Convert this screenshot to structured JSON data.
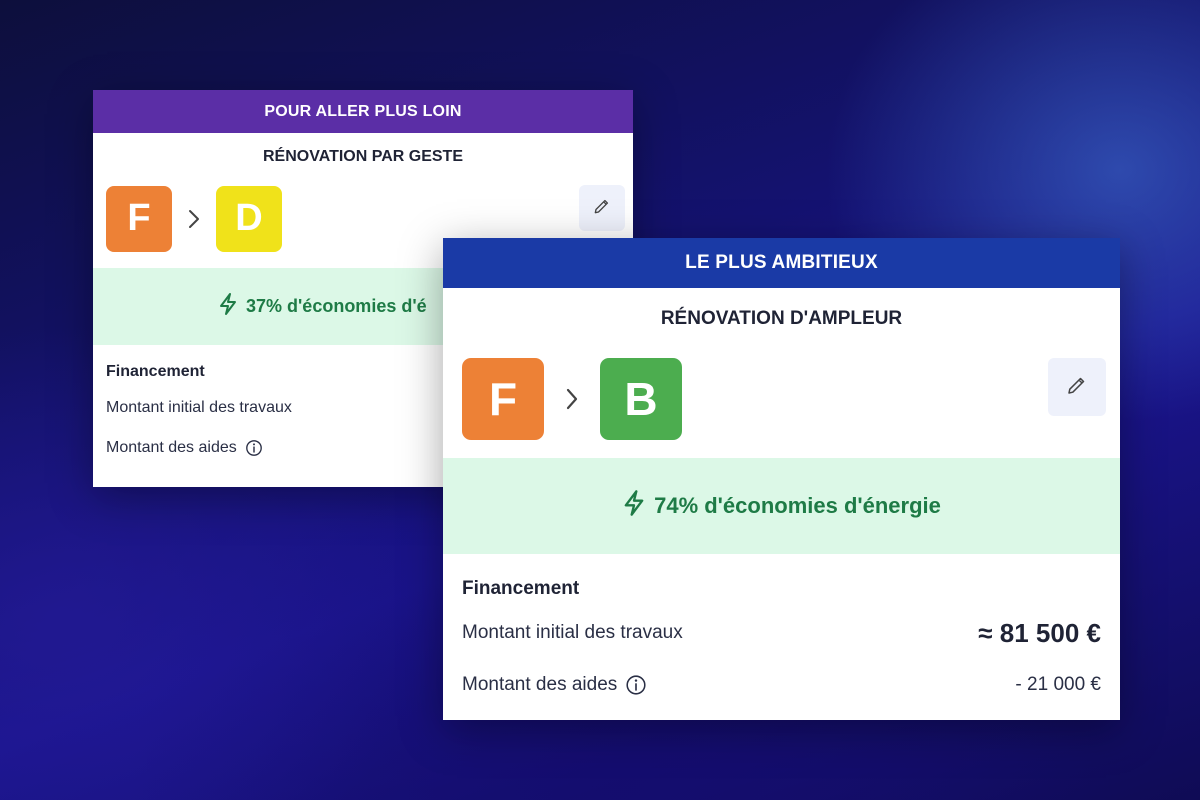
{
  "colors": {
    "banner_back": "#5b2ea6",
    "banner_front": "#1a3aa6",
    "class_f": "#ed8136",
    "class_d": "#f0e21a",
    "class_b": "#4cad4f",
    "savings_bg": "#dcf8e7",
    "savings_text": "#1e7b46"
  },
  "card_back": {
    "banner": "POUR ALLER PLUS LOIN",
    "subtitle": "RÉNOVATION PAR GESTE",
    "class_from": "F",
    "class_to": "D",
    "savings_text": "37% d'économies d'é",
    "financement_title": "Financement",
    "row_initial_label": "Montant initial des travaux",
    "row_aides_label": "Montant des aides"
  },
  "card_front": {
    "banner": "LE PLUS AMBITIEUX",
    "subtitle": "RÉNOVATION D'AMPLEUR",
    "class_from": "F",
    "class_to": "B",
    "savings_text": "74% d'économies d'énergie",
    "financement_title": "Financement",
    "row_initial_label": "Montant initial des travaux",
    "row_initial_value": "≈ 81 500 €",
    "row_aides_label": "Montant des aides",
    "row_aides_value": "- 21 000 €"
  },
  "icons": {
    "arrow": "chevron-right-icon",
    "edit": "pencil-icon",
    "savings": "lightning-icon",
    "info": "info-icon"
  }
}
